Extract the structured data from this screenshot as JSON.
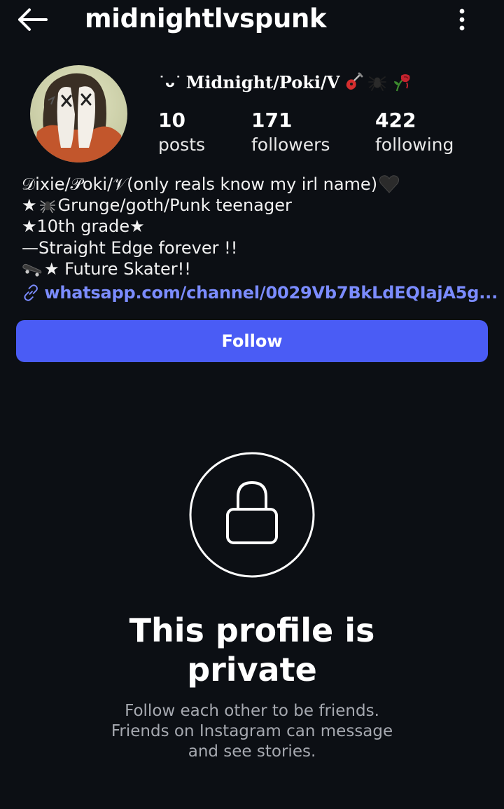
{
  "header": {
    "username": "midnightlvspunk",
    "back_icon": "arrow-left-icon",
    "more_icon": "vertical-dots-icon"
  },
  "profile": {
    "display_name": "Midnight/Poki/V",
    "display_name_prefix": "˙ᴗ˙",
    "display_name_emojis": [
      "guitar-icon",
      "spider-icon",
      "wilted-rose-icon"
    ],
    "stats": [
      {
        "count": "10",
        "label": "posts"
      },
      {
        "count": "171",
        "label": "followers"
      },
      {
        "count": "422",
        "label": "following"
      }
    ],
    "bio": [
      {
        "text": "𝒟ixie/𝒫oki/𝒱(only reals know my irl name)",
        "suffix_icon": "black-heart-icon"
      },
      {
        "prefix": "★",
        "prefix_icon": "spider-icon",
        "text": "Grunge/goth/Punk teenager"
      },
      {
        "text": "★10th grade★"
      },
      {
        "text": "—Straight Edge forever !!"
      },
      {
        "prefix_icon": "skateboard-icon",
        "text": "★ Future Skater!!"
      }
    ],
    "link": "whatsapp.com/channel/0029Vb7BkLdEQIajA5g..."
  },
  "actions": {
    "follow_label": "Follow"
  },
  "private": {
    "title_line1": "This profile is",
    "title_line2": "private",
    "sub_line1": "Follow each other to be friends.",
    "sub_line2": "Friends on Instagram can message",
    "sub_line3": "and see stories."
  },
  "colors": {
    "background": "#0c0f14",
    "follow_button": "#4a5cf5",
    "link": "#7b8cff",
    "muted_text": "#a6a9b0"
  }
}
